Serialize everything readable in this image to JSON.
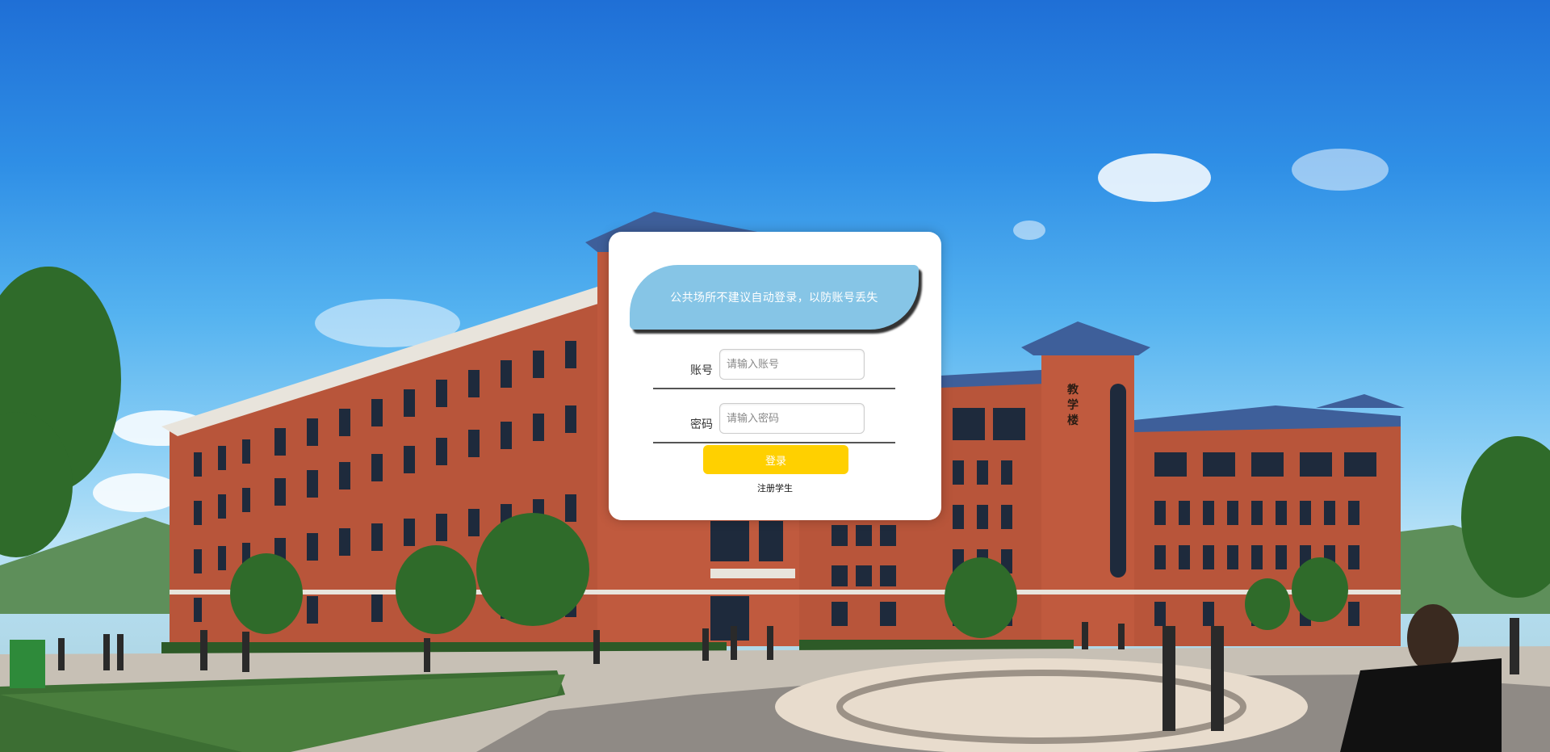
{
  "login": {
    "notice": "公共场所不建议自动登录，以防账号丢失",
    "account": {
      "label": "账号",
      "placeholder": "请输入账号",
      "value": ""
    },
    "password": {
      "label": "密码",
      "placeholder": "请输入密码",
      "value": ""
    },
    "login_button": "登录",
    "register_link": "注册学生"
  },
  "background": {
    "building_sign": "教学楼",
    "colors": {
      "sky_top": "#1f6fd6",
      "sky_bottom": "#b8e2f7",
      "brick": "#b8553a",
      "roof": "#3e5f9a",
      "notice_bg": "#86c5e6",
      "button_bg": "#ffd000"
    }
  }
}
